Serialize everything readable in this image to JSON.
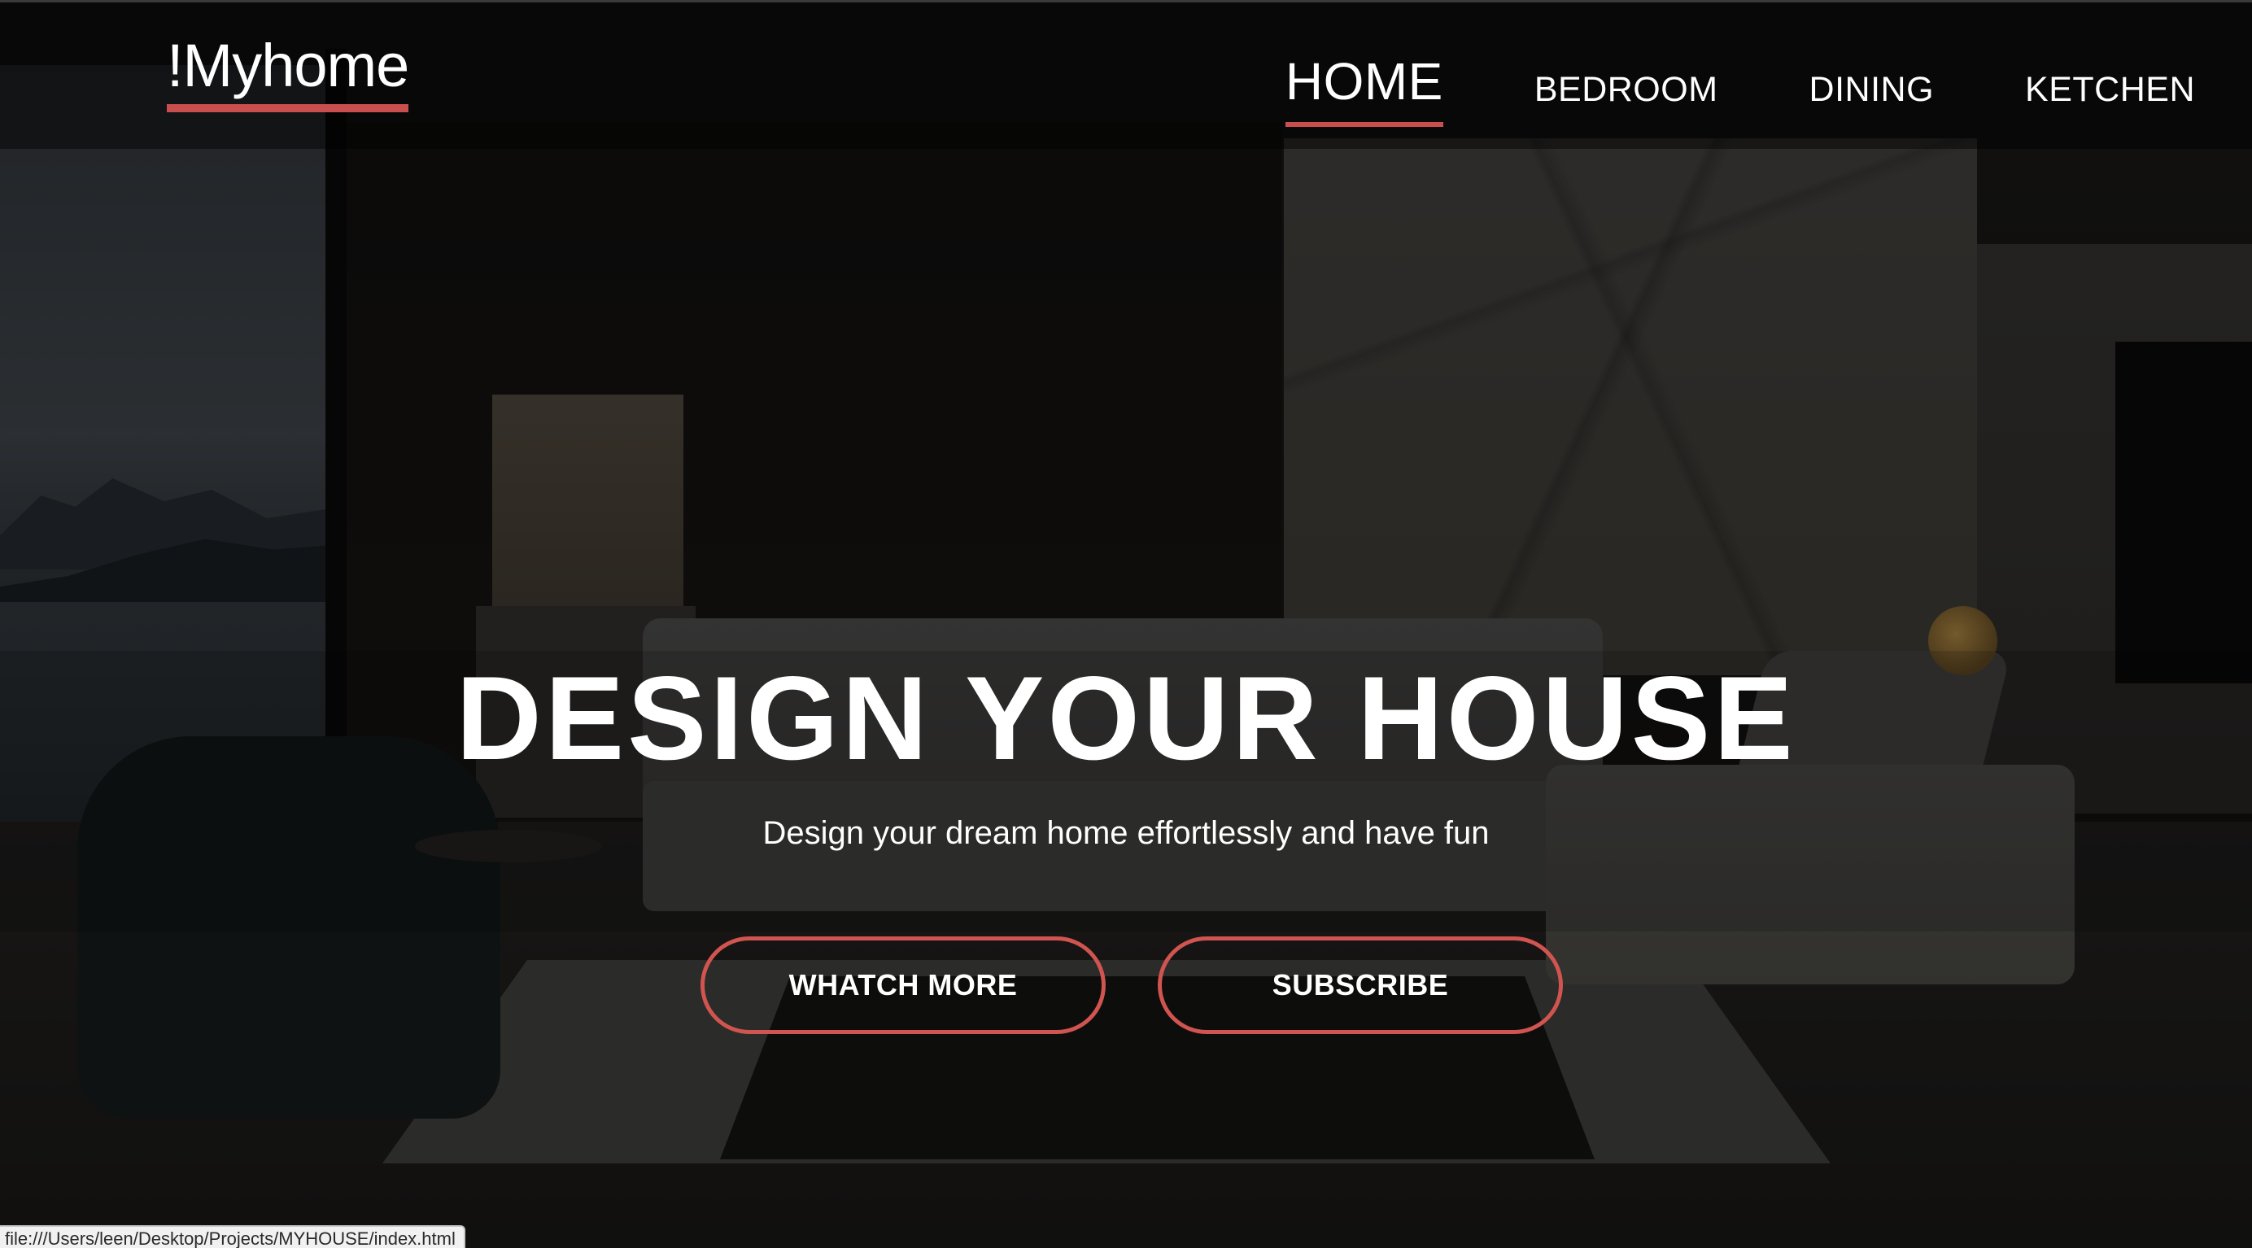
{
  "brand": {
    "logo_text": "!Myhome",
    "accent_color": "#c94f4f"
  },
  "nav": {
    "items": [
      {
        "label": "HOME",
        "active": true
      },
      {
        "label": "BEDROOM",
        "active": false
      },
      {
        "label": "DINING",
        "active": false
      },
      {
        "label": "KETCHEN",
        "active": false
      }
    ]
  },
  "hero": {
    "title": "DESIGN YOUR HOUSE",
    "subtitle": "Design your dream home effortlessly and have fun",
    "buttons": {
      "watch_more": "WHATCH MORE",
      "subscribe": "SUBSCRIBE"
    }
  },
  "status_bar": {
    "url": "file:///Users/leen/Desktop/Projects/MYHOUSE/index.html"
  }
}
